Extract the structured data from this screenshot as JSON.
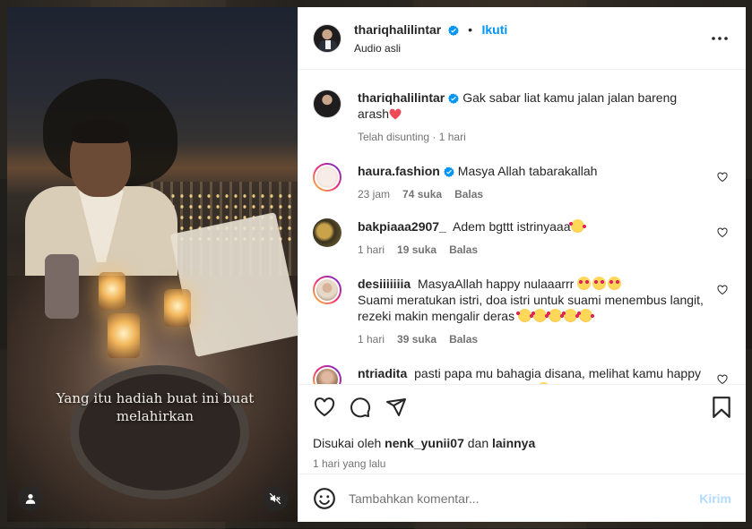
{
  "post": {
    "username": "thariqhalilintar",
    "follow_label": "Ikuti",
    "audio": "Audio asli",
    "caption_overlay": "Yang itu hadiah buat ini buat melahirkan"
  },
  "caption": {
    "username": "thariqhalilintar",
    "text": "Gak sabar liat kamu jalan jalan bareng arash",
    "meta": "Telah disunting · 1 hari"
  },
  "comments": [
    {
      "username": "haura.fashion",
      "text": "Masya Allah tabarakallah",
      "time": "23 jam",
      "likes": "74 suka",
      "reply": "Balas"
    },
    {
      "username": "bakpiaaa2907_",
      "text": "Adem bgttt istrinyaaa",
      "time": "1 hari",
      "likes": "19 suka",
      "reply": "Balas"
    },
    {
      "username": "desiiiiiiia",
      "text_line1": "MasyaAllah happy nulaaarrr",
      "text_line2": "Suami meratukan istri, doa istri untuk suami menembus langit, rezeki makin mengalir deras",
      "time": "1 hari",
      "likes": "39 suka",
      "reply": "Balas"
    },
    {
      "username": "ntriadita",
      "text": "pasti papa mu bahagia disana, melihat kamu happy bersama orang yang kamu cinta"
    }
  ],
  "likes": {
    "prefix": "Disukai oleh",
    "user": "nenk_yunii07",
    "joiner": "dan",
    "others": "lainnya"
  },
  "posted_time": "1 hari yang lalu",
  "composer": {
    "placeholder": "Tambahkan komentar...",
    "post_label": "Kirim"
  },
  "icons": [
    "verified-badge-icon",
    "more-options-icon",
    "like-icon",
    "comment-icon",
    "share-icon",
    "bookmark-icon",
    "emoji-icon",
    "user-tag-icon",
    "mute-icon"
  ],
  "colors": {
    "accent": "#0095f6",
    "verified": "#0095f6",
    "heart_red": "#ed4956",
    "post_disabled": "#b3dbff"
  }
}
